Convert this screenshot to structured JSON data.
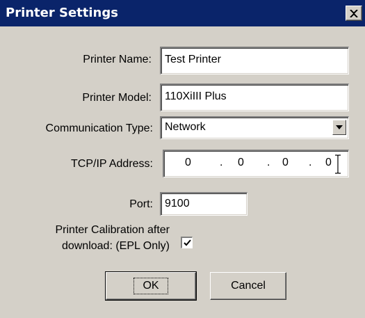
{
  "window": {
    "title": "Printer Settings",
    "close_glyph": "✕"
  },
  "form": {
    "printer_name": {
      "label": "Printer Name:",
      "value": "Test Printer"
    },
    "printer_model": {
      "label": "Printer Model:",
      "value": "110XiIII Plus"
    },
    "communication_type": {
      "label": "Communication Type:",
      "value": "Network"
    },
    "ip_address": {
      "label": "TCP/IP Address:",
      "octets": [
        "0",
        "0",
        "0",
        "0"
      ],
      "separator": "."
    },
    "port": {
      "label": "Port:",
      "value": "9100"
    },
    "calibration": {
      "label_line1": "Printer Calibration after",
      "label_line2": "download: (EPL Only)",
      "checked": true
    }
  },
  "buttons": {
    "ok_label": "OK",
    "cancel_label": "Cancel"
  },
  "colors": {
    "titlebar": "#0a246a",
    "dialog_bg": "#d4d0c8"
  },
  "icons": [
    "close-icon",
    "chevron-down-icon",
    "checkmark-icon",
    "text-cursor-icon"
  ]
}
